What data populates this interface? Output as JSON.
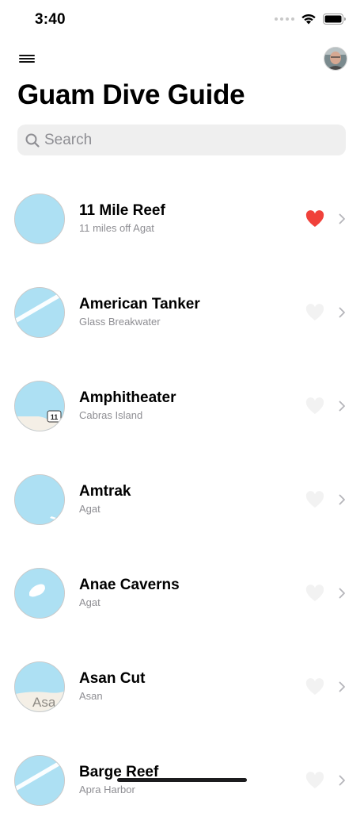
{
  "status_bar": {
    "time": "3:40"
  },
  "header": {
    "title": "Guam Dive Guide"
  },
  "search": {
    "placeholder": "Search"
  },
  "colors": {
    "heart_active": "#f0413a",
    "heart_inactive": "#f2f2f2",
    "water": "#ade0f3",
    "land": "#f4efe6"
  },
  "sites": [
    {
      "name": "11 Mile Reef",
      "location": "11 miles off Agat",
      "favorite": true,
      "map": "water"
    },
    {
      "name": "American Tanker",
      "location": "Glass Breakwater",
      "favorite": false,
      "map": "breakwater"
    },
    {
      "name": "Amphitheater",
      "location": "Cabras Island",
      "favorite": false,
      "map": "shore",
      "map_label": "11"
    },
    {
      "name": "Amtrak",
      "location": "Agat",
      "favorite": false,
      "map": "water-corner"
    },
    {
      "name": "Anae Caverns",
      "location": "Agat",
      "favorite": false,
      "map": "island"
    },
    {
      "name": "Asan Cut",
      "location": "Asan",
      "favorite": false,
      "map": "coast",
      "map_label": "Asa"
    },
    {
      "name": "Barge Reef",
      "location": "Apra Harbor",
      "favorite": false,
      "map": "breakwater"
    }
  ]
}
